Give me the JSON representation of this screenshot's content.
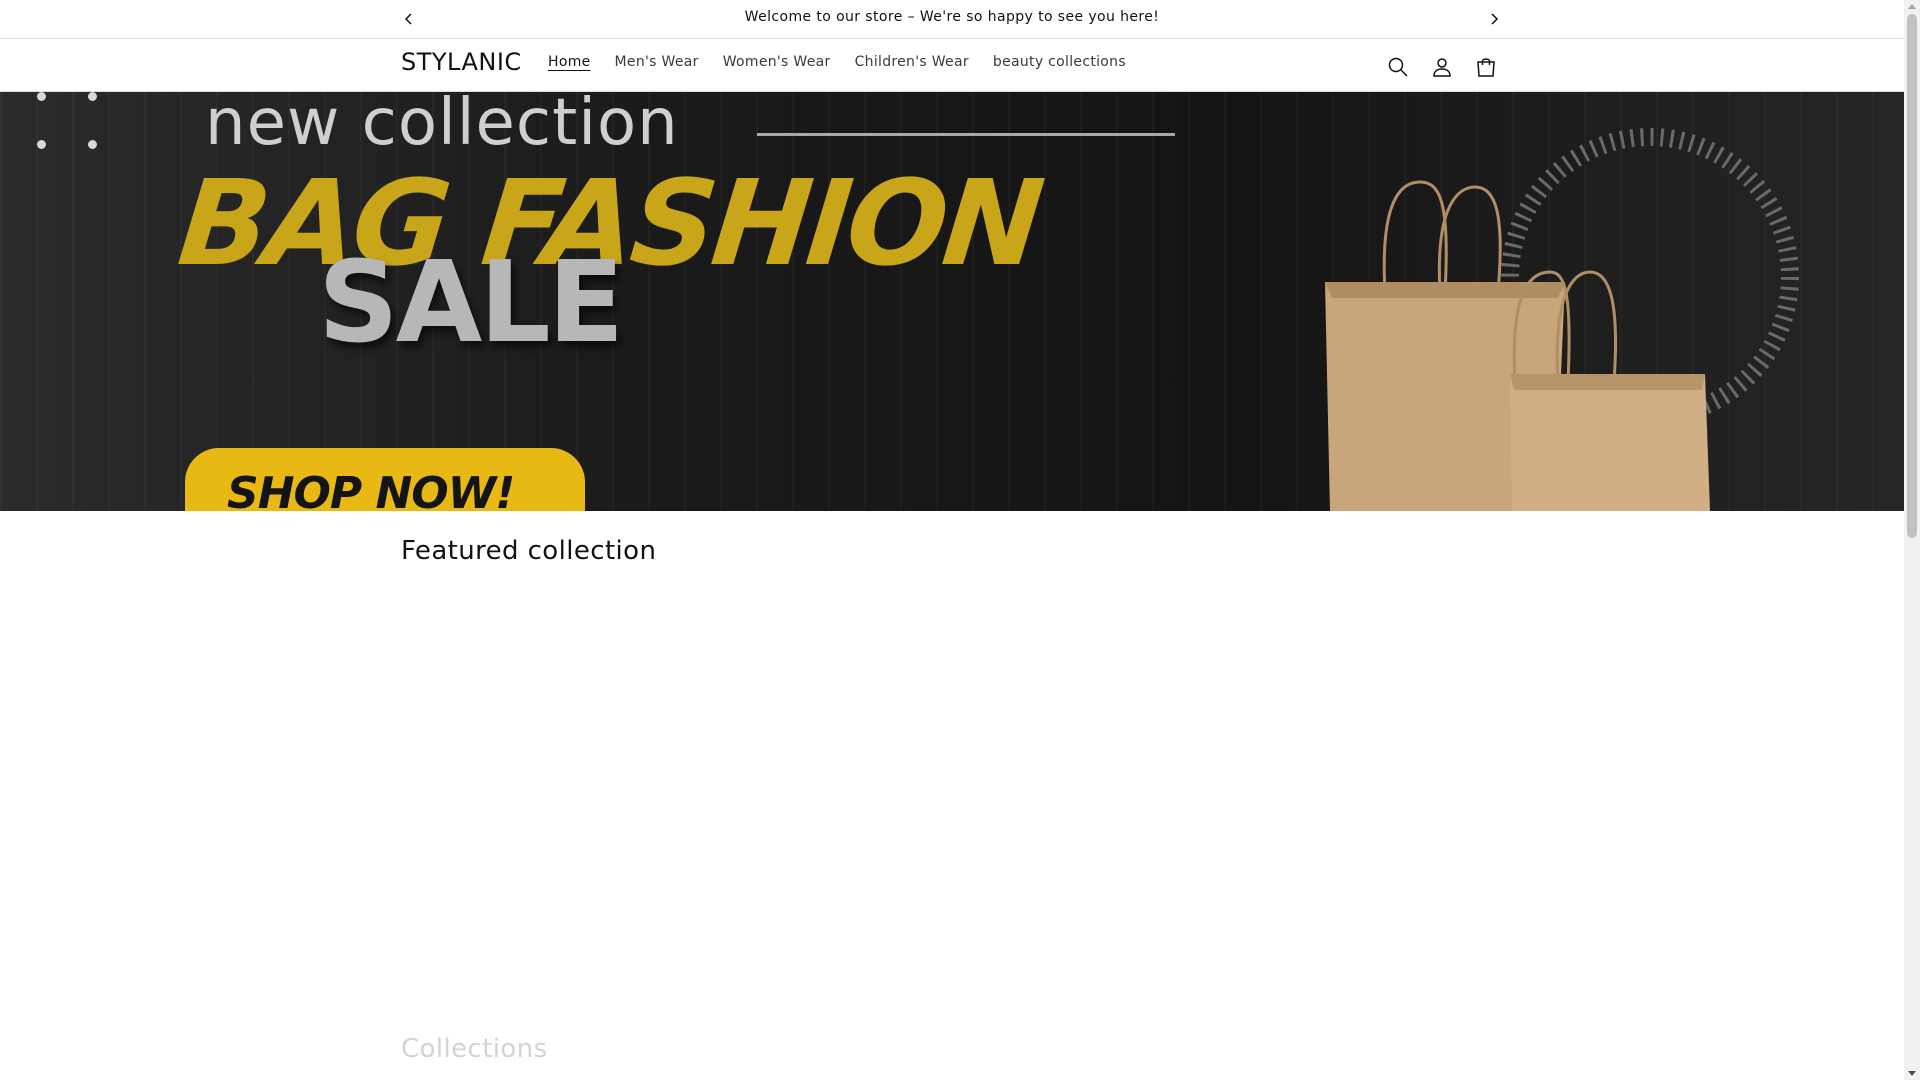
{
  "announcement": {
    "message": "Welcome to our store – We're so happy to see you here!",
    "prev_icon": "chevron-left-icon",
    "next_icon": "chevron-right-icon"
  },
  "header": {
    "logo": "STYLANIC",
    "nav": [
      {
        "label": "Home",
        "active": true
      },
      {
        "label": "Men's Wear",
        "active": false
      },
      {
        "label": "Women's Wear",
        "active": false
      },
      {
        "label": "Children's Wear",
        "active": false
      },
      {
        "label": "beauty collections",
        "active": false
      }
    ],
    "icons": [
      "search-icon",
      "account-icon",
      "cart-icon"
    ]
  },
  "banner": {
    "eyebrow": "new collection",
    "headline": "BAG FASHION",
    "subheadline": "SALE",
    "cta": "SHOP NOW!",
    "colors": {
      "headline": "#c9a619",
      "cta_bg": "#e8b915",
      "background": "#1a1a1a"
    }
  },
  "featured": {
    "title": "Featured collection"
  },
  "collections": {
    "title": "Collections"
  }
}
